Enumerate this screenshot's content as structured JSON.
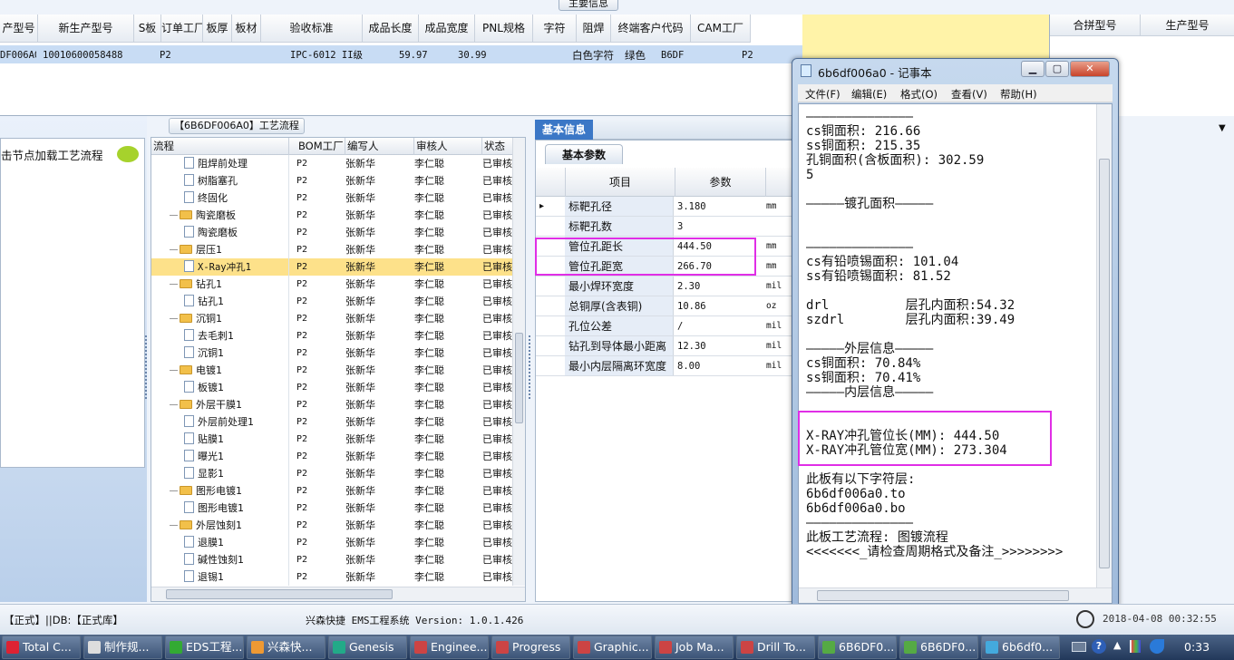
{
  "main_info_tab": "主要信息",
  "grid_headers": [
    "产型号",
    "新生产型号",
    "S板",
    "订单工厂",
    "板厚",
    "板材",
    "验收标准",
    "成品长度",
    "成品宽度",
    "PNL规格",
    "字符",
    "阻焊",
    "终端客户代码",
    "CAM工厂"
  ],
  "grid_row": {
    "c0": "DF006A0",
    "c1": "10010600058488",
    "c3": "P2",
    "c6": "IPC-6012 II级",
    "c7": "59.97",
    "c8": "30.99",
    "c10": "白色字符",
    "c11": "绿色",
    "c12": "B6DF",
    "c13": "P2"
  },
  "right_headers": [
    "合拼型号",
    "生产型号"
  ],
  "left_panel_text": "击节点加载工艺流程",
  "flow_tab": "【6B6DF006A0】工艺流程",
  "flow_headers": [
    "流程",
    "BOM工厂",
    "编写人",
    "审核人",
    "状态"
  ],
  "flow_rows": [
    {
      "name": "阻焊前处理",
      "kind": "doc",
      "bom": "P2",
      "writer": "张新华",
      "reviewer": "李仁聪",
      "status": "已审核"
    },
    {
      "name": "树脂塞孔",
      "kind": "doc",
      "bom": "P2",
      "writer": "张新华",
      "reviewer": "李仁聪",
      "status": "已审核"
    },
    {
      "name": "终固化",
      "kind": "doc",
      "bom": "P2",
      "writer": "张新华",
      "reviewer": "李仁聪",
      "status": "已审核"
    },
    {
      "name": "陶瓷磨板",
      "kind": "folder",
      "bom": "P2",
      "writer": "张新华",
      "reviewer": "李仁聪",
      "status": "已审核"
    },
    {
      "name": "陶瓷磨板",
      "kind": "doc",
      "bom": "P2",
      "writer": "张新华",
      "reviewer": "李仁聪",
      "status": "已审核"
    },
    {
      "name": "层压1",
      "kind": "folder",
      "bom": "P2",
      "writer": "张新华",
      "reviewer": "李仁聪",
      "status": "已审核"
    },
    {
      "name": "X-Ray冲孔1",
      "kind": "doc",
      "bom": "P2",
      "writer": "张新华",
      "reviewer": "李仁聪",
      "status": "已审核",
      "selected": true
    },
    {
      "name": "钻孔1",
      "kind": "folder",
      "bom": "P2",
      "writer": "张新华",
      "reviewer": "李仁聪",
      "status": "已审核"
    },
    {
      "name": "钻孔1",
      "kind": "doc",
      "bom": "P2",
      "writer": "张新华",
      "reviewer": "李仁聪",
      "status": "已审核"
    },
    {
      "name": "沉铜1",
      "kind": "folder",
      "bom": "P2",
      "writer": "张新华",
      "reviewer": "李仁聪",
      "status": "已审核"
    },
    {
      "name": "去毛刺1",
      "kind": "doc",
      "bom": "P2",
      "writer": "张新华",
      "reviewer": "李仁聪",
      "status": "已审核"
    },
    {
      "name": "沉铜1",
      "kind": "doc",
      "bom": "P2",
      "writer": "张新华",
      "reviewer": "李仁聪",
      "status": "已审核"
    },
    {
      "name": "电镀1",
      "kind": "folder",
      "bom": "P2",
      "writer": "张新华",
      "reviewer": "李仁聪",
      "status": "已审核"
    },
    {
      "name": "板镀1",
      "kind": "doc",
      "bom": "P2",
      "writer": "张新华",
      "reviewer": "李仁聪",
      "status": "已审核"
    },
    {
      "name": "外层干膜1",
      "kind": "folder",
      "bom": "P2",
      "writer": "张新华",
      "reviewer": "李仁聪",
      "status": "已审核"
    },
    {
      "name": "外层前处理1",
      "kind": "doc",
      "bom": "P2",
      "writer": "张新华",
      "reviewer": "李仁聪",
      "status": "已审核"
    },
    {
      "name": "贴膜1",
      "kind": "doc",
      "bom": "P2",
      "writer": "张新华",
      "reviewer": "李仁聪",
      "status": "已审核"
    },
    {
      "name": "曝光1",
      "kind": "doc",
      "bom": "P2",
      "writer": "张新华",
      "reviewer": "李仁聪",
      "status": "已审核"
    },
    {
      "name": "显影1",
      "kind": "doc",
      "bom": "P2",
      "writer": "张新华",
      "reviewer": "李仁聪",
      "status": "已审核"
    },
    {
      "name": "图形电镀1",
      "kind": "folder",
      "bom": "P2",
      "writer": "张新华",
      "reviewer": "李仁聪",
      "status": "已审核"
    },
    {
      "name": "图形电镀1",
      "kind": "doc",
      "bom": "P2",
      "writer": "张新华",
      "reviewer": "李仁聪",
      "status": "已审核"
    },
    {
      "name": "外层蚀刻1",
      "kind": "folder",
      "bom": "P2",
      "writer": "张新华",
      "reviewer": "李仁聪",
      "status": "已审核"
    },
    {
      "name": "退膜1",
      "kind": "doc",
      "bom": "P2",
      "writer": "张新华",
      "reviewer": "李仁聪",
      "status": "已审核"
    },
    {
      "name": "碱性蚀刻1",
      "kind": "doc",
      "bom": "P2",
      "writer": "张新华",
      "reviewer": "李仁聪",
      "status": "已审核"
    },
    {
      "name": "退锡1",
      "kind": "doc",
      "bom": "P2",
      "writer": "张新华",
      "reviewer": "李仁聪",
      "status": "已审核"
    }
  ],
  "basic_tab": "基本信息",
  "basic_subtab": "基本参数",
  "param_headers": [
    "项目",
    "参数"
  ],
  "params": [
    {
      "label": "标靶孔径",
      "value": "3.180",
      "unit": "mm"
    },
    {
      "label": "标靶孔数",
      "value": "3",
      "unit": ""
    },
    {
      "label": "管位孔距长",
      "value": "444.50",
      "unit": "mm"
    },
    {
      "label": "管位孔距宽",
      "value": "266.70",
      "unit": "mm"
    },
    {
      "label": "最小焊环宽度",
      "value": "2.30",
      "unit": "mil"
    },
    {
      "label": "总铜厚(含表铜)",
      "value": "10.86",
      "unit": "oz"
    },
    {
      "label": "孔位公差",
      "value": "/",
      "unit": "mil"
    },
    {
      "label": "钻孔到导体最小距离",
      "value": "12.30",
      "unit": "mil"
    },
    {
      "label": "最小内层隔离环宽度",
      "value": "8.00",
      "unit": "mil"
    }
  ],
  "notepad": {
    "title": "6b6df006a0 - 记事本",
    "menu": [
      "文件(F)",
      "编辑(E)",
      "格式(O)",
      "查看(V)",
      "帮助(H)"
    ],
    "lines": [
      "——————————————",
      "cs铜面积: 216.66",
      "ss铜面积: 215.35",
      "孔铜面积(含板面积): 302.59",
      "5",
      "",
      "—————镀孔面积—————",
      "",
      "",
      "——————————————",
      "cs有铅喷锡面积: 101.04",
      "ss有铅喷锡面积: 81.52",
      "",
      "drl          层孔内面积:54.32",
      "szdrl        层孔内面积:39.49",
      "",
      "—————外层信息—————",
      "cs铜面积: 70.84%",
      "ss铜面积: 70.41%",
      "—————内层信息—————",
      "",
      "",
      "X-RAY冲孔管位长(MM): 444.50",
      "X-RAY冲孔管位宽(MM): 273.304",
      "——————————————",
      "此板有以下字符层:",
      "6b6df006a0.to",
      "6b6df006a0.bo",
      "——————————————",
      "此板工艺流程: 图镀流程",
      "<<<<<<<_请检查周期格式及备注_>>>>>>>>"
    ]
  },
  "status_bar": {
    "left": "【正式】||DB:【正式库】",
    "center": "兴森快捷 EMS工程系统 Version: 1.0.1.426",
    "datetime": "2018-04-08 00:32:55"
  },
  "taskbar": {
    "items": [
      "Total C...",
      "制作规...",
      "EDS工程...",
      "兴森快...",
      "Genesis",
      "Enginee...",
      "Progress",
      "Graphic...",
      "Job Ma...",
      "Drill To...",
      "6B6DF0...",
      "6B6DF0...",
      "6b6df0..."
    ],
    "clock": "0:33"
  },
  "colors": {
    "highlight": "#e02ee6",
    "selected_row": "#fde18a",
    "tab_blue": "#3b77c6"
  }
}
